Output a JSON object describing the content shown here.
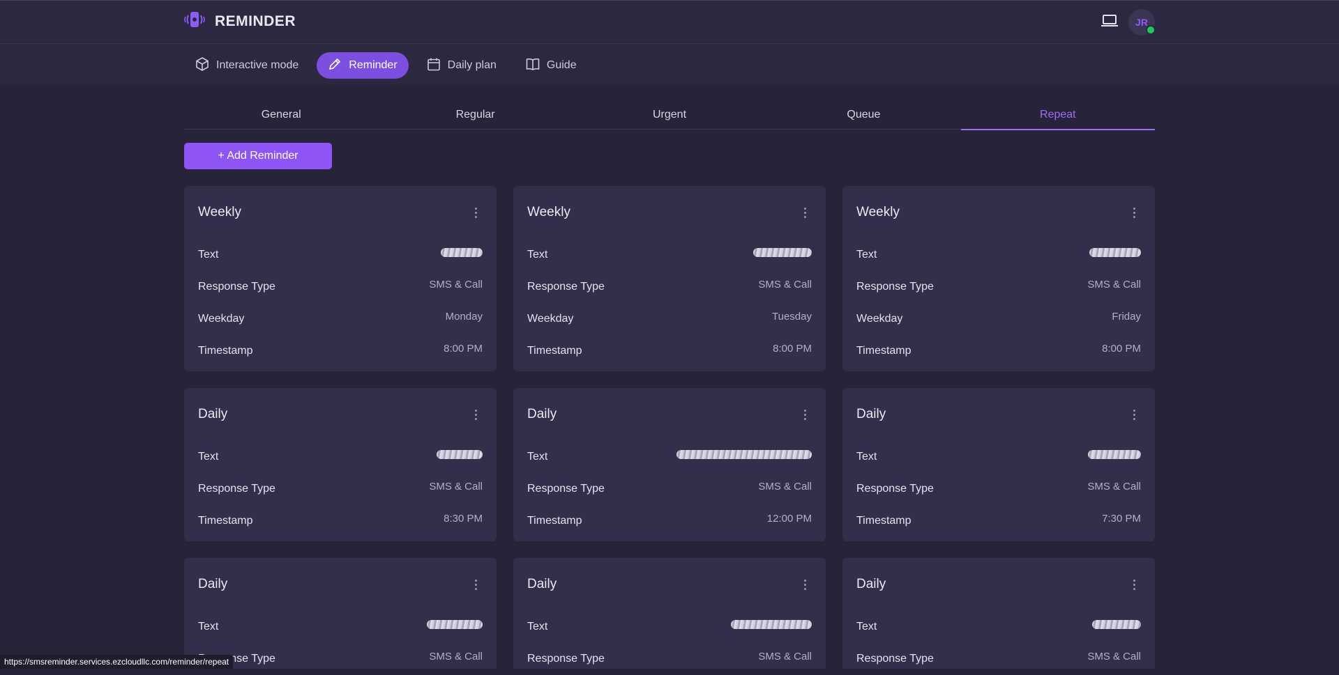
{
  "app": {
    "title": "REMINDER",
    "avatar_initials": "JR",
    "accent_color": "#8e55f4",
    "online_color": "#22c55e"
  },
  "nav": {
    "items": [
      {
        "label": "Interactive mode",
        "icon": "cube-icon",
        "active": false
      },
      {
        "label": "Reminder",
        "icon": "pencil-icon",
        "active": true
      },
      {
        "label": "Daily plan",
        "icon": "calendar-icon",
        "active": false
      },
      {
        "label": "Guide",
        "icon": "book-icon",
        "active": false
      }
    ]
  },
  "tabs": [
    "General",
    "Regular",
    "Urgent",
    "Queue",
    "Repeat"
  ],
  "active_tab": "Repeat",
  "add_button_label": "+ Add Reminder",
  "labels": {
    "text": "Text",
    "response_type": "Response Type",
    "weekday": "Weekday",
    "timestamp": "Timestamp"
  },
  "cards": [
    {
      "title": "Weekly",
      "text_redacted": true,
      "response_type": "SMS & Call",
      "weekday": "Monday",
      "timestamp": "8:00 PM"
    },
    {
      "title": "Weekly",
      "text_redacted": true,
      "response_type": "SMS & Call",
      "weekday": "Tuesday",
      "timestamp": "8:00 PM"
    },
    {
      "title": "Weekly",
      "text_redacted": true,
      "response_type": "SMS & Call",
      "weekday": "Friday",
      "timestamp": "8:00 PM"
    },
    {
      "title": "Daily",
      "text_redacted": true,
      "response_type": "SMS & Call",
      "timestamp": "8:30 PM"
    },
    {
      "title": "Daily",
      "text_redacted": true,
      "response_type": "SMS & Call",
      "timestamp": "12:00 PM"
    },
    {
      "title": "Daily",
      "text_redacted": true,
      "response_type": "SMS & Call",
      "timestamp": "7:30 PM"
    },
    {
      "title": "Daily",
      "text_redacted": true,
      "response_type": "SMS & Call"
    },
    {
      "title": "Daily",
      "text_redacted": true,
      "response_type": "SMS & Call"
    },
    {
      "title": "Daily",
      "text_redacted": true,
      "response_type": "SMS & Call"
    }
  ],
  "status_url": "https://smsreminder.services.ezcloudllc.com/reminder/repeat"
}
